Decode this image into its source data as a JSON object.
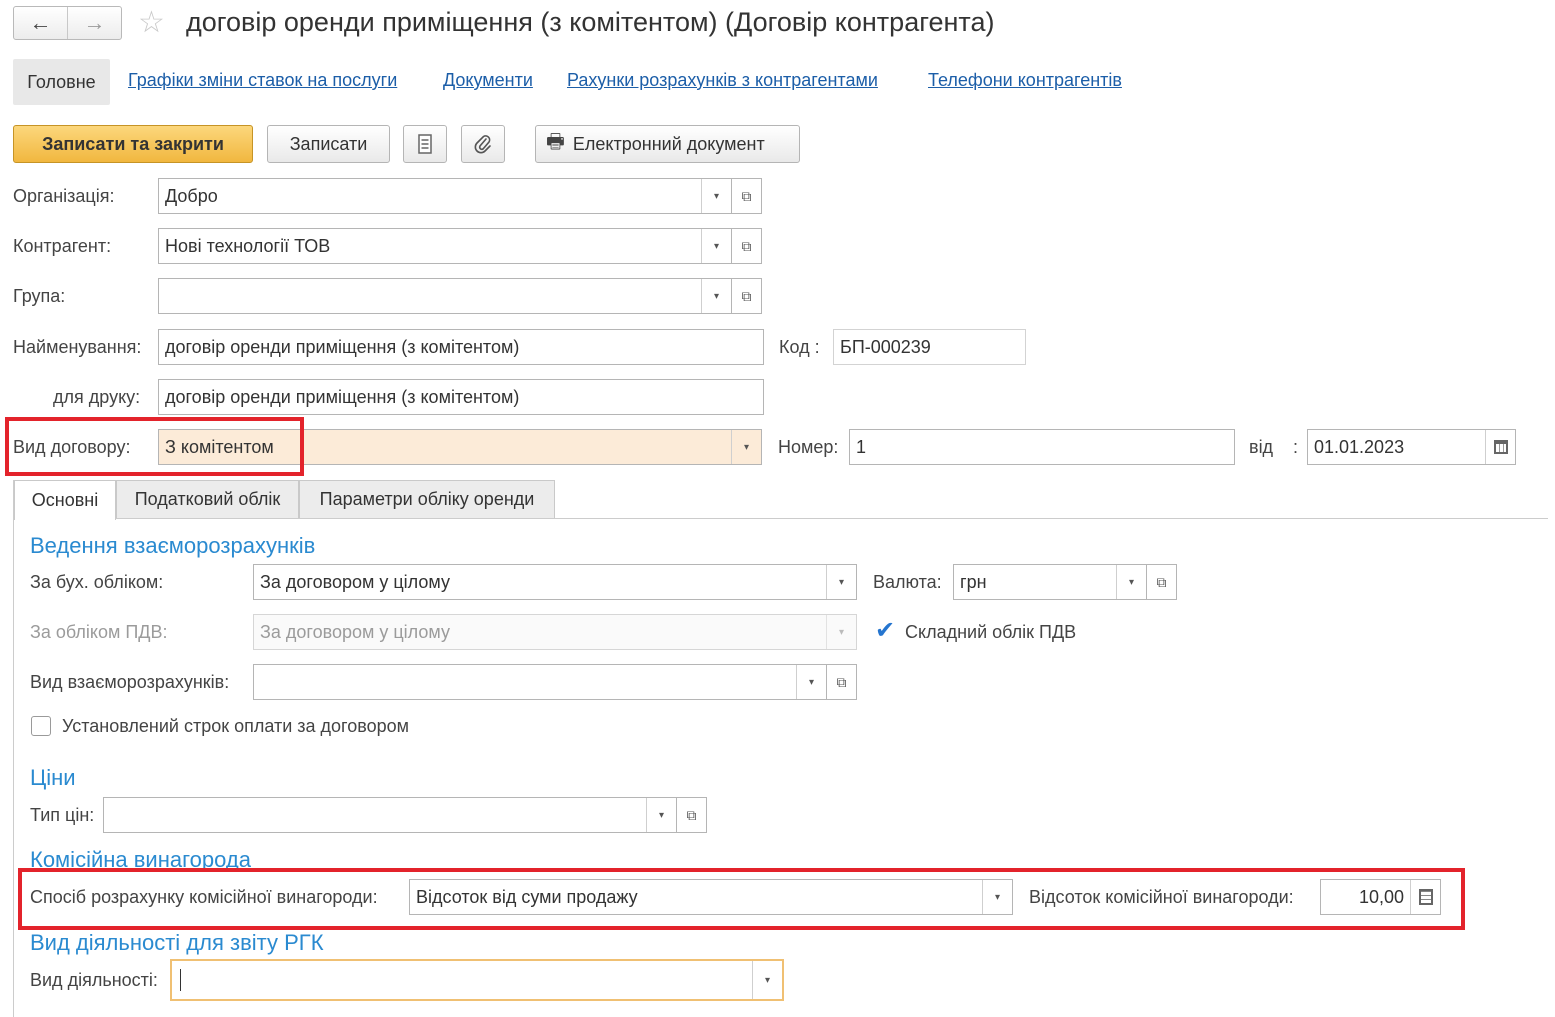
{
  "window": {
    "title": "договір оренди приміщення (з комітентом) (Договір контрагента)",
    "back_glyph": "←",
    "forward_glyph": "→",
    "star_glyph": "☆"
  },
  "nav": {
    "items": [
      {
        "label": "Головне"
      },
      {
        "label": "Графіки зміни ставок на послуги"
      },
      {
        "label": "Документи"
      },
      {
        "label": "Рахунки розрахунків з контрагентами"
      },
      {
        "label": "Телефони контрагентів"
      }
    ]
  },
  "toolbar": {
    "save_close": "Записати та закрити",
    "save": "Записати",
    "e_document": "Електронний документ",
    "printer_glyph": "🖶",
    "clip_glyph": "📎"
  },
  "form": {
    "organization": {
      "label": "Організація:",
      "value": "Добро"
    },
    "counterparty": {
      "label": "Контрагент:",
      "value": "Нові технології ТОВ"
    },
    "group": {
      "label": "Група:",
      "value": ""
    },
    "name": {
      "label": "Найменування:",
      "value": "договір оренди приміщення (з комітентом)"
    },
    "code": {
      "label": "Код :",
      "value": "БП-000239"
    },
    "print_name": {
      "label": "для друку:",
      "value": "договір оренди приміщення (з комітентом)"
    },
    "contract_type": {
      "label": "Вид договору:",
      "value": "З комітентом"
    },
    "number": {
      "label": "Номер:",
      "value": "1"
    },
    "date": {
      "label": "від",
      "colon": ":",
      "value": "01.01.2023"
    }
  },
  "tabs": [
    {
      "label": "Основні"
    },
    {
      "label": "Податковий облік"
    },
    {
      "label": "Параметри обліку оренди"
    }
  ],
  "settlements": {
    "heading": "Ведення взаєморозрахунків",
    "accounting": {
      "label": "За бух. обліком:",
      "value": "За договором у цілому"
    },
    "currency": {
      "label": "Валюта:",
      "value": "грн"
    },
    "vat": {
      "label": "За обліком ПДВ:",
      "value": "За договором у цілому"
    },
    "complex_vat": {
      "label": "Складний облік ПДВ",
      "checked": true
    },
    "settlement_type": {
      "label": "Вид взаєморозрахунків:",
      "value": ""
    },
    "payment_term": {
      "label": "Установлений строк оплати за договором",
      "checked": false
    }
  },
  "prices": {
    "heading": "Ціни",
    "price_type": {
      "label": "Тип цін:",
      "value": ""
    }
  },
  "commission": {
    "heading": "Комісійна винагорода",
    "method": {
      "label": "Спосіб розрахунку комісійної винагороди:",
      "value": "Відсоток від суми продажу"
    },
    "percent": {
      "label": "Відсоток комісійної винагороди:",
      "value": "10,00"
    }
  },
  "activity": {
    "heading": "Вид діяльності для звіту РГК",
    "type": {
      "label": "Вид діяльності:",
      "value": ""
    }
  },
  "glyphs": {
    "dropdown": "▾",
    "open": "⧉",
    "check": "✔"
  },
  "colors": {
    "accent_blue": "#2a8ad0",
    "link_blue": "#1c5ea8",
    "primary_button": "#f1b73f",
    "highlight_red": "#e3232b",
    "focus_orange": "#f0c073",
    "peach_field": "#fcebd8"
  }
}
